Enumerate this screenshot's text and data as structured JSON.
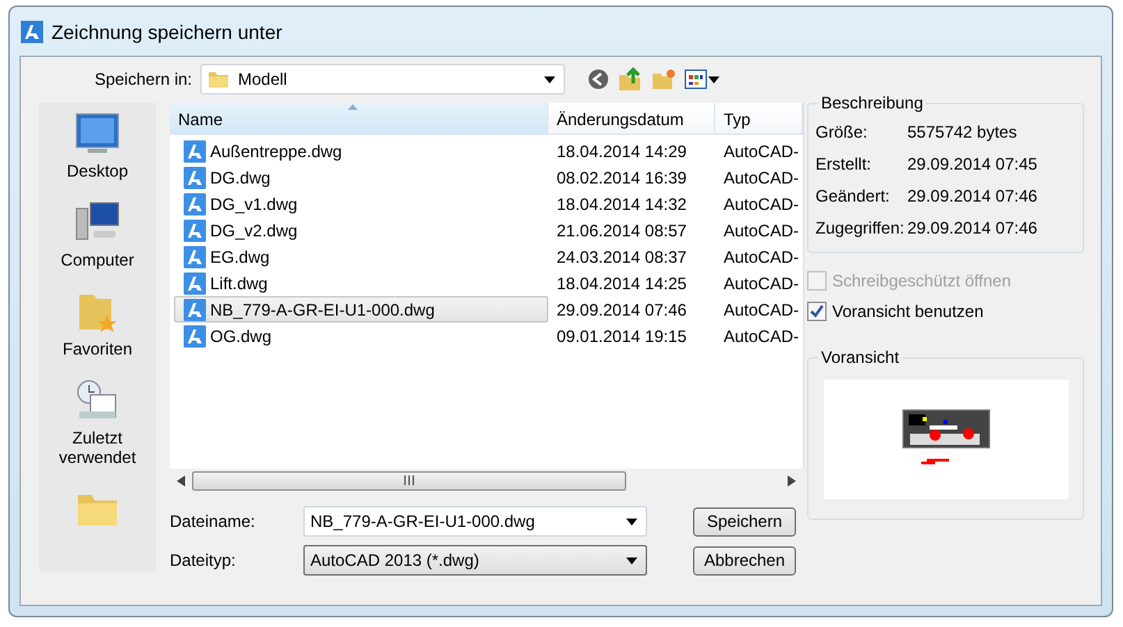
{
  "window": {
    "title": "Zeichnung speichern unter"
  },
  "save_in": {
    "label": "Speichern in:",
    "value": "Modell"
  },
  "places": [
    {
      "kind": "desktop",
      "label": "Desktop"
    },
    {
      "kind": "computer",
      "label": "Computer"
    },
    {
      "kind": "favorites",
      "label": "Favoriten"
    },
    {
      "kind": "recent",
      "label": "Zuletzt verwendet"
    },
    {
      "kind": "documents"
    }
  ],
  "file_list": {
    "columns": [
      {
        "label": "Name",
        "sorted": true
      },
      {
        "label": "Änderungsdatum",
        "sorted": false
      },
      {
        "label": "Typ",
        "sorted": false
      }
    ],
    "rows": [
      {
        "name": "Außentreppe.dwg",
        "modified": "18.04.2014 14:29",
        "type": "AutoCAD-",
        "selected": false
      },
      {
        "name": "DG.dwg",
        "modified": "08.02.2014 16:39",
        "type": "AutoCAD-",
        "selected": false
      },
      {
        "name": "DG_v1.dwg",
        "modified": "18.04.2014 14:32",
        "type": "AutoCAD-",
        "selected": false
      },
      {
        "name": "DG_v2.dwg",
        "modified": "21.06.2014 08:57",
        "type": "AutoCAD-",
        "selected": false
      },
      {
        "name": "EG.dwg",
        "modified": "24.03.2014 08:37",
        "type": "AutoCAD-",
        "selected": false
      },
      {
        "name": "Lift.dwg",
        "modified": "18.04.2014 14:25",
        "type": "AutoCAD-",
        "selected": false
      },
      {
        "name": "NB_779-A-GR-EI-U1-000.dwg",
        "modified": "29.09.2014 07:46",
        "type": "AutoCAD-",
        "selected": true
      },
      {
        "name": "OG.dwg",
        "modified": "09.01.2014 19:15",
        "type": "AutoCAD-",
        "selected": false
      }
    ]
  },
  "file_name": {
    "label": "Dateiname:",
    "value": "NB_779-A-GR-EI-U1-000.dwg"
  },
  "file_type": {
    "label": "Dateityp:",
    "value": "AutoCAD 2013 (*.dwg)"
  },
  "buttons": [
    "Speichern",
    "Abbrechen"
  ],
  "description": {
    "title": "Beschreibung",
    "fields": [
      {
        "label": "Größe:",
        "value": "5575742 bytes"
      },
      {
        "label": "Erstellt:",
        "value": "29.09.2014 07:45"
      },
      {
        "label": "Geändert:",
        "value": "29.09.2014 07:46"
      },
      {
        "label": "Zugegriffen:",
        "value": "29.09.2014 07:46"
      }
    ]
  },
  "options": [
    {
      "label": "Schreibgeschützt öffnen",
      "checked": false,
      "disabled": true
    },
    {
      "label": "Voransicht benutzen",
      "checked": true,
      "disabled": false
    }
  ],
  "preview": {
    "title": "Voransicht"
  }
}
